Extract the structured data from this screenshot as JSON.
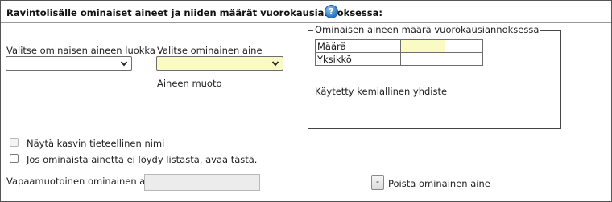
{
  "header": {
    "title": "Ravintolisälle ominaiset aineet ja niiden määrät vuorokausiannoksessa:",
    "help_icon": "question-mark-circle"
  },
  "category": {
    "label": "Valitse ominaisen aineen luokka",
    "selected": ""
  },
  "substance": {
    "label": "Valitse ominainen aine",
    "selected": "",
    "form_label": "Aineen muoto"
  },
  "amount_fieldset": {
    "legend": "Ominaisen aineen määrä vuorokausiannoksessa",
    "rows": [
      {
        "label": "Määrä",
        "value": "",
        "extra": ""
      },
      {
        "label": "Yksikkö",
        "value": "",
        "extra": ""
      }
    ],
    "chemical_label": "Käytetty kemiallinen yhdiste"
  },
  "options": {
    "show_scientific_name": "Näytä kasvin tieteellinen nimi",
    "not_found": "Jos ominaista ainetta ei löydy listasta, avaa tästä."
  },
  "freeform": {
    "label": "Vapaamuotoinen ominainen aine",
    "value": ""
  },
  "remove": {
    "button_label": "-",
    "label": "Poista ominainen aine"
  },
  "colors": {
    "highlight_field": "#fafac4",
    "help_icon": "#2a78c4"
  }
}
